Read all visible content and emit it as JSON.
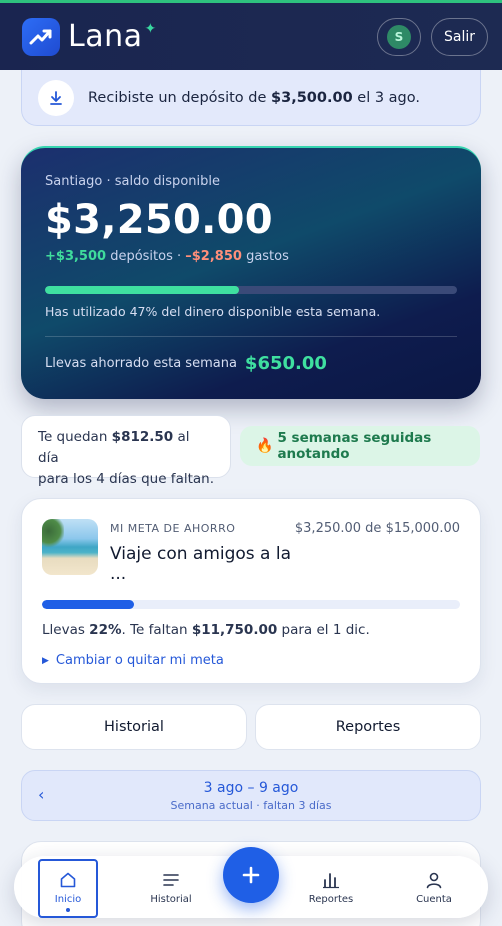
{
  "header": {
    "app_name": "Lana",
    "avatar_initial": "S",
    "logout_label": "Salir"
  },
  "notice": {
    "prefix": "Recibiste un depósito de ",
    "amount": "$3,500.00",
    "suffix": " el 3 ago."
  },
  "balance": {
    "label": "Santiago · saldo disponible",
    "amount": "$3,250.00",
    "deposits_amount": "+$3,500",
    "deposits_label": " depósitos · ",
    "expenses_amount": "–$2,850",
    "expenses_label": " gastos",
    "used_fraction": 0.47,
    "usage_text": "Has utilizado 47% del dinero disponible esta semana.",
    "saved_label": "Llevas ahorrado esta semana",
    "saved_amount": "$650.00"
  },
  "daily": {
    "line1_prefix": "Te quedan ",
    "amount": "$812.50",
    "line1_suffix": " al día",
    "line2": "para los 4 días que faltan."
  },
  "streak": {
    "icon": "fire-icon",
    "text": "5 semanas seguidas anotando"
  },
  "goal": {
    "kicker": "MI META DE AHORRO",
    "name": "Viaje con amigos a la ...",
    "amount_text": "$3,250.00 de $15,000.00",
    "progress_fraction": 0.22,
    "progress_prefix": "Llevas ",
    "progress_percent": "22%",
    "progress_mid": ". Te faltan ",
    "remaining": "$11,750.00",
    "progress_suffix": " para el 1 dic.",
    "change_link": "Cambiar o quitar mi meta"
  },
  "tabs": {
    "history": "Historial",
    "reports": "Reportes"
  },
  "week": {
    "prev_icon": "‹",
    "range": "3 ago – 9 ago",
    "subtitle": "Semana actual · faltan 3 días"
  },
  "bottom_nav": {
    "home": "Inicio",
    "history": "Historial",
    "reports": "Reportes",
    "account": "Cuenta",
    "add_icon": "plus-icon"
  },
  "colors": {
    "accent": "#1f5fe6",
    "positive": "#3fdc9c",
    "negative": "#ff8f7a",
    "header_bg": "#1a2550"
  }
}
